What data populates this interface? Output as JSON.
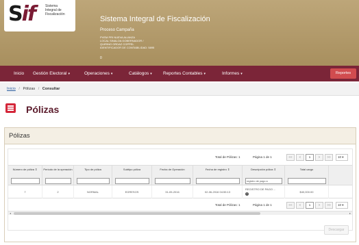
{
  "header": {
    "logo_mark": "S",
    "logo_mark_suffix": "if",
    "logo_sub": [
      "Sistema",
      "Integral de",
      "Fiscalización"
    ],
    "system_title": "Sistema Integral de Fiscalización",
    "process_line": "Proceso Campaña",
    "detail_lines": [
      "PVEM PRI NUEVA ALIANZA",
      "LOCAL SINALOA GOBERNADOR /",
      "QUIRINO ORDAZ COPPEL",
      "IDENTIFICADOR DE CONTABILIDAD: 5895"
    ],
    "mark": "0"
  },
  "nav": {
    "items": [
      "Inicio",
      "Gestión Electoral",
      "Operaciones",
      "Catálogos",
      "Reportes Contables",
      "Informes"
    ],
    "reportes_button": "Reportes"
  },
  "breadcrumb": {
    "home": "Inicio",
    "section": "Pólizas",
    "current": "Consultar"
  },
  "page": {
    "title": "Pólizas",
    "panel_title": "Pólizas"
  },
  "pager": {
    "total_label": "Total de Pólizas: 1",
    "page_label": "Página 1 de 1",
    "current_page": "1",
    "page_size": "10",
    "first": "<<",
    "prev": "<",
    "next": ">",
    "last": ">>"
  },
  "table": {
    "columns": [
      {
        "label": "Número de póliza ⇕",
        "filter": ""
      },
      {
        "label": "Periodo de la operación",
        "filter": ""
      },
      {
        "label": "Tipo de póliza",
        "filter": ""
      },
      {
        "label": "Subtipo póliza",
        "filter": ""
      },
      {
        "label": "Fecha de Operación",
        "filter": ""
      },
      {
        "label": "Fecha de registro ⇕",
        "filter": ""
      },
      {
        "label": "Descripción póliza ⇕",
        "filter": "registro de pago a"
      },
      {
        "label": "Total cargo",
        "filter": ""
      }
    ],
    "rows": [
      [
        "7",
        "2",
        "NORMAL",
        "EGRESOS",
        "31-05-2016",
        "02-06-2016 04:55:13",
        "REGISTRO DE PAGO ...",
        "$40,000.00"
      ]
    ],
    "info_icon": "i"
  },
  "download_button": "Descargar"
}
